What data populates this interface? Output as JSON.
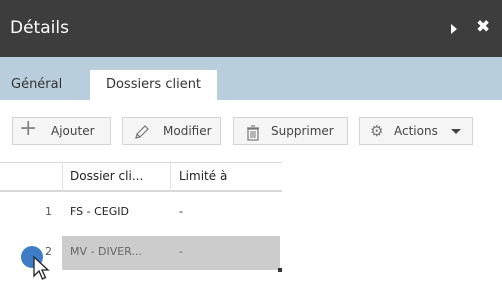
{
  "window": {
    "title": "Détails"
  },
  "tabs": [
    {
      "label": "Général"
    },
    {
      "label": "Dossiers client"
    }
  ],
  "toolbar": {
    "add_label": "Ajouter",
    "edit_label": "Modifier",
    "delete_label": "Supprimer",
    "actions_label": "Actions"
  },
  "table": {
    "columns": [
      "Dossier cli...",
      "Limité à"
    ],
    "rows": [
      {
        "num": "1",
        "dossier": "FS - CEGID",
        "limite": "-"
      },
      {
        "num": "2",
        "dossier": "MV - DIVER...",
        "limite": "-"
      }
    ]
  },
  "icons": {
    "expand": "play-triangle-icon",
    "close": "close-x-icon",
    "add": "plus-icon",
    "edit": "pencil-icon",
    "delete": "trash-icon",
    "actions": "gear-icon"
  },
  "colors": {
    "titlebar": "#3d3d3d",
    "tabstrip": "#b8cedd",
    "selected_row": "#cccccc",
    "cursor_dot": "#3f7cc8"
  }
}
